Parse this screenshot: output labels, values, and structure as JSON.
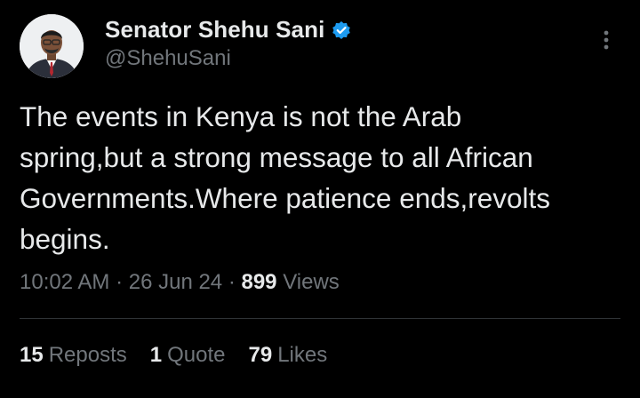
{
  "author": {
    "display_name": "Senator Shehu Sani",
    "handle": "@ShehuSani",
    "verified_icon": "verified-badge-icon",
    "avatar": "profile-photo"
  },
  "tweet": {
    "text": "The events in Kenya is not the Arab\nspring,but a strong message to all African\nGovernments.Where patience ends,revolts\nbegins."
  },
  "meta": {
    "time": "10:02 AM",
    "separator1": " · ",
    "date": "26 Jun 24",
    "separator2": " · ",
    "views_count": "899",
    "views_label": "Views"
  },
  "stats": {
    "reposts_count": "15",
    "reposts_label": "Reposts",
    "quotes_count": "1",
    "quotes_label": "Quote",
    "likes_count": "79",
    "likes_label": "Likes"
  },
  "colors": {
    "background": "#000000",
    "primary_text": "#e7e9ea",
    "secondary_text": "#71767b",
    "verified_blue": "#1d9bf0",
    "divider": "#2f3336"
  },
  "icons": {
    "more": "more-vertical-icon"
  }
}
